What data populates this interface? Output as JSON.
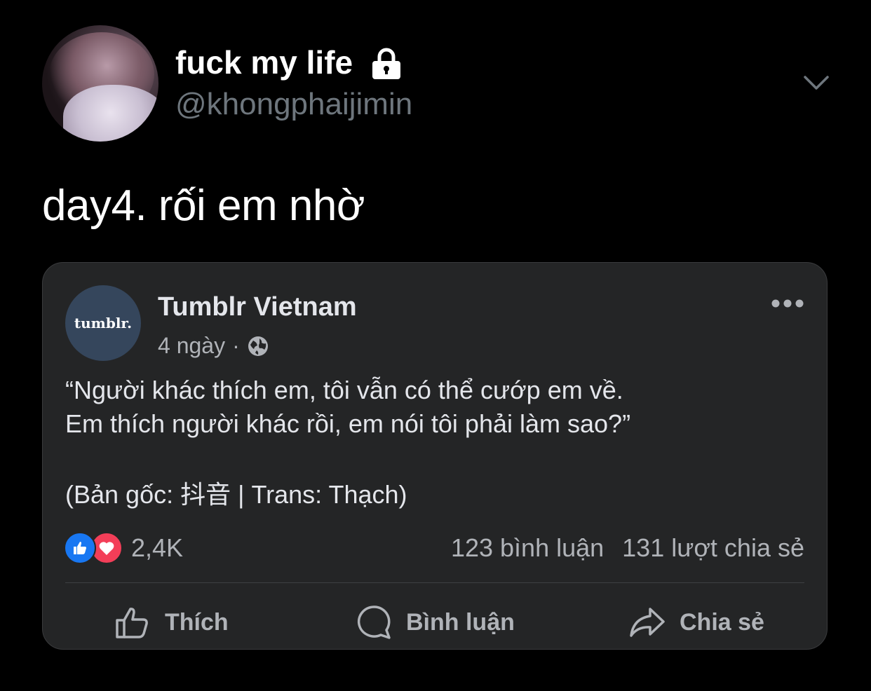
{
  "tweet": {
    "display_name": "fuck my life",
    "handle": "@khongphaijimin",
    "text": "day4. rối em nhờ"
  },
  "embedded_post": {
    "page_name": "Tumblr Vietnam",
    "page_avatar_text": "tumblr.",
    "time": "4 ngày",
    "separator": "·",
    "body_lines": [
      "“Người khác thích em, tôi vẫn có thể cướp em về.",
      "Em thích người khác rồi, em nói tôi phải làm sao?”"
    ],
    "source": "(Bản gốc: 抖音 | Trans: Thạch)",
    "reaction_count": "2,4K",
    "comments": "123 bình luận",
    "shares": "131 lượt chia sẻ",
    "actions": {
      "like": "Thích",
      "comment": "Bình luận",
      "share": "Chia sẻ"
    }
  },
  "icons": [
    "lock-icon",
    "chevron-down-icon",
    "globe-icon",
    "more-icon",
    "like-reaction-icon",
    "love-reaction-icon",
    "thumbs-up-icon",
    "comment-icon",
    "share-icon"
  ],
  "colors": {
    "background": "#000000",
    "card": "#242526",
    "secondary_text": "#b0b3b8",
    "handle_text": "#6e767d",
    "like_blue": "#1877f2",
    "love_red": "#f33e58",
    "tumblr_avatar": "#35465c"
  }
}
